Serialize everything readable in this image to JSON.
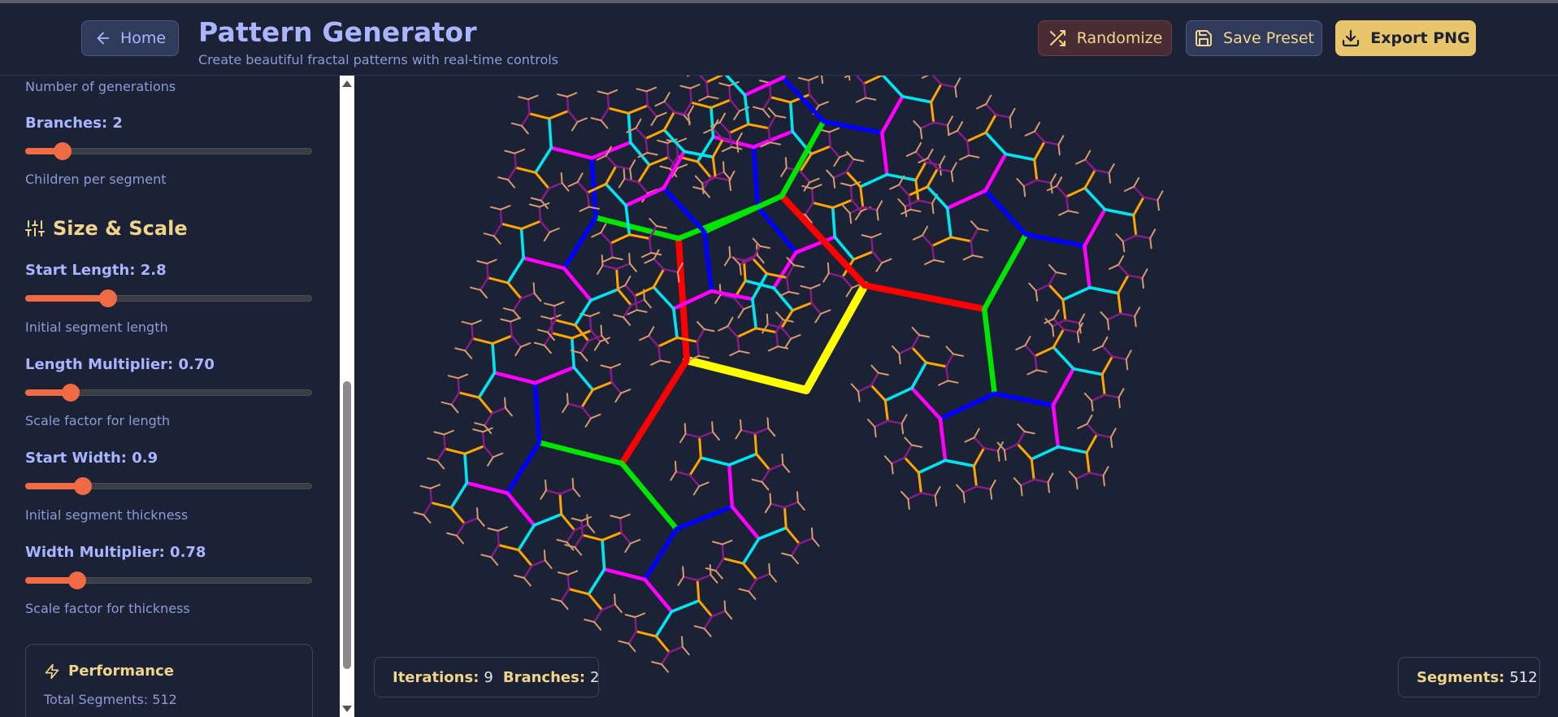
{
  "header": {
    "home_label": "Home",
    "title": "Pattern Generator",
    "subtitle": "Create beautiful fractal patterns with real-time controls",
    "randomize_label": "Randomize",
    "save_label": "Save Preset",
    "export_label": "Export PNG"
  },
  "sidebar": {
    "iterations_help": "Number of generations",
    "branches_label": "Branches: 2",
    "branches_help": "Children per segment",
    "branches_level": 0.13,
    "section_title": "Size & Scale",
    "start_length_label": "Start Length: 2.8",
    "start_length_help": "Initial segment length",
    "start_length_level": 0.29,
    "length_mult_label": "Length Multiplier: 0.70",
    "length_mult_help": "Scale factor for length",
    "length_mult_level": 0.16,
    "start_width_label": "Start Width: 0.9",
    "start_width_help": "Initial segment thickness",
    "start_width_level": 0.2,
    "width_mult_label": "Width Multiplier: 0.78",
    "width_mult_help": "Scale factor for thickness",
    "width_mult_level": 0.18,
    "performance_title": "Performance",
    "total_segments": "Total Segments: 512"
  },
  "stats": {
    "iterations_key": "Iterations:",
    "iterations_value": "9",
    "branches_key": "Branches:",
    "branches_value": "2",
    "segments_key": "Segments:",
    "segments_value": "512"
  },
  "colors": {
    "accent": "#f06a43",
    "highlight": "#f0d48a",
    "generation_colors": [
      "#ffff00",
      "#ff0000",
      "#00e600",
      "#0000ff",
      "#ff00ff",
      "#00e5f0",
      "#ffa500",
      "#8b1a8b",
      "#d99a6c"
    ]
  },
  "icons": {
    "home": "arrow-left-icon",
    "randomize": "shuffle-icon",
    "save": "save-icon",
    "export": "download-icon",
    "section": "sliders-icon",
    "performance": "zap-icon"
  }
}
